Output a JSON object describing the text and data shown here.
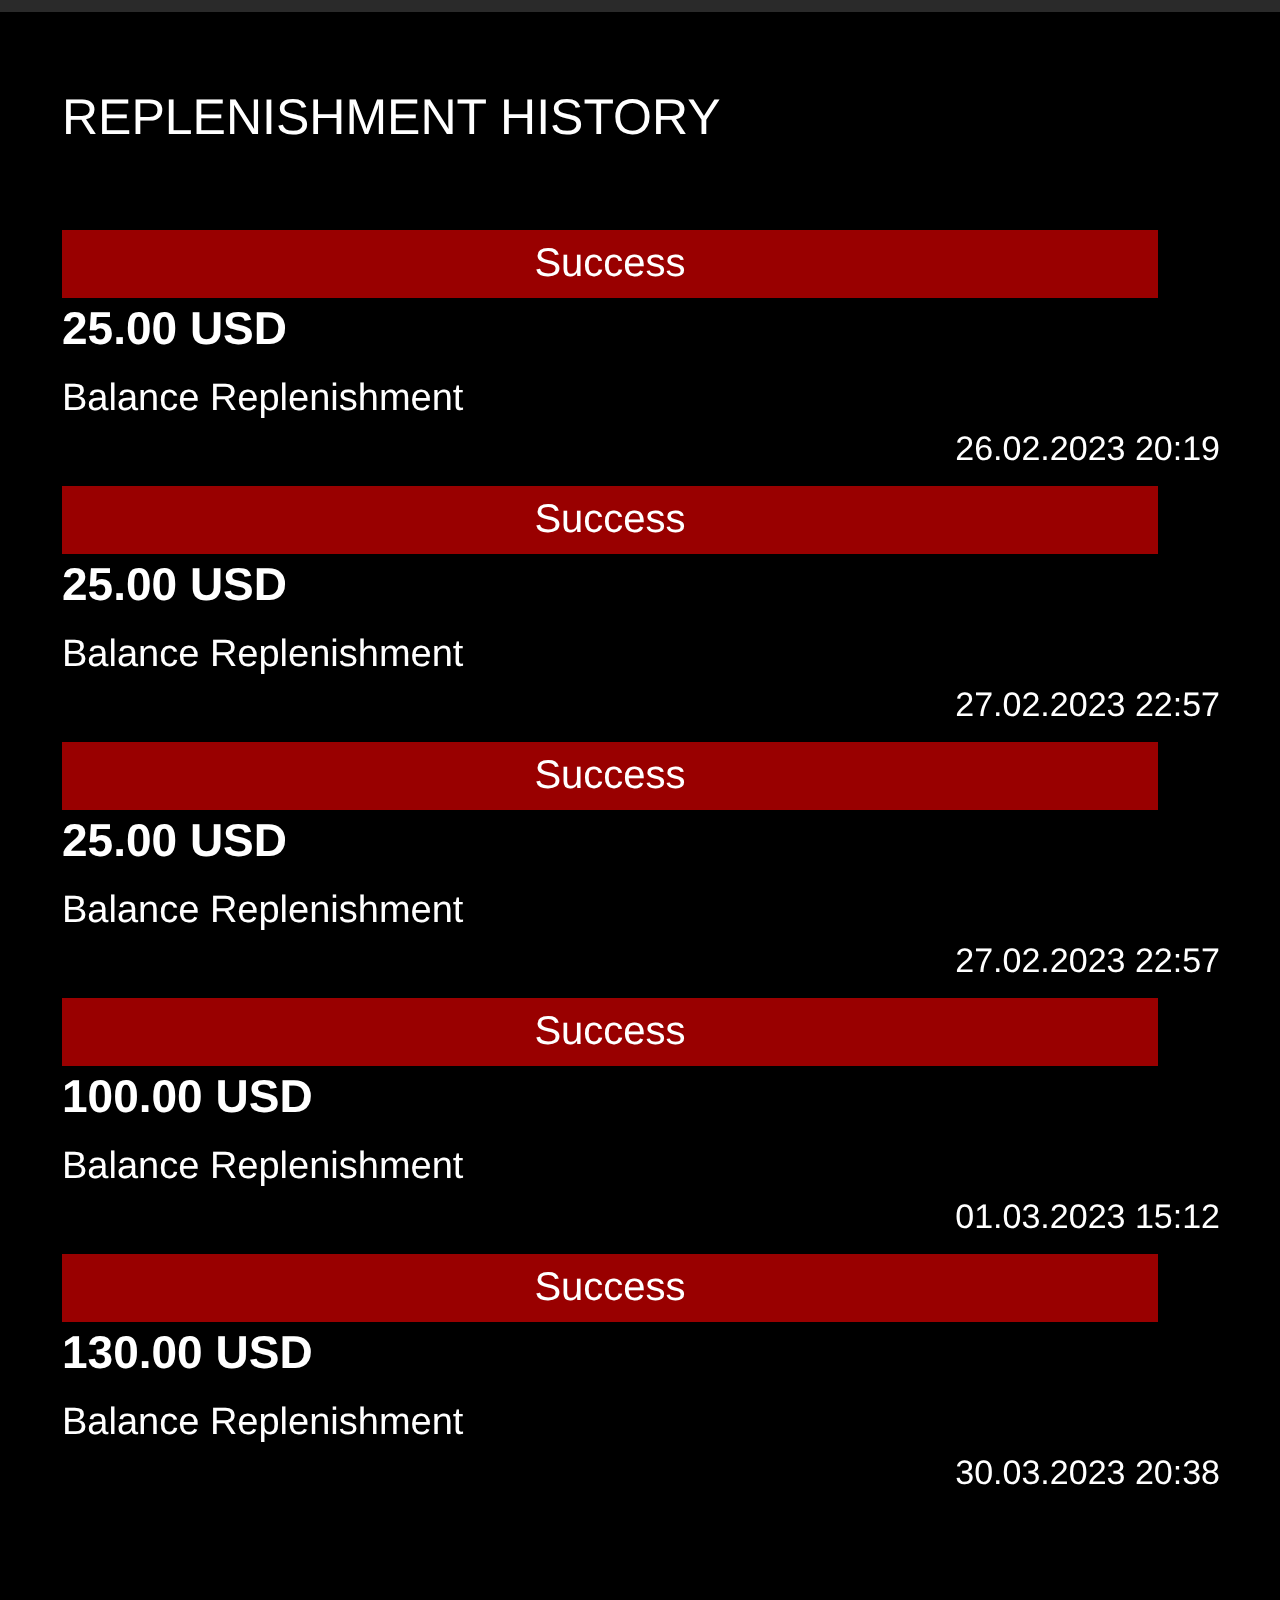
{
  "title": "REPLENISHMENT HISTORY",
  "transactions": [
    {
      "status": "Success",
      "amount": "25.00 USD",
      "description": "Balance Replenishment",
      "date": "26.02.2023 20:19"
    },
    {
      "status": "Success",
      "amount": "25.00 USD",
      "description": "Balance Replenishment",
      "date": "27.02.2023 22:57"
    },
    {
      "status": "Success",
      "amount": "25.00 USD",
      "description": "Balance Replenishment",
      "date": "27.02.2023 22:57"
    },
    {
      "status": "Success",
      "amount": "100.00 USD",
      "description": "Balance Replenishment",
      "date": "01.03.2023 15:12"
    },
    {
      "status": "Success",
      "amount": "130.00 USD",
      "description": "Balance Replenishment",
      "date": "30.03.2023 20:38"
    }
  ]
}
